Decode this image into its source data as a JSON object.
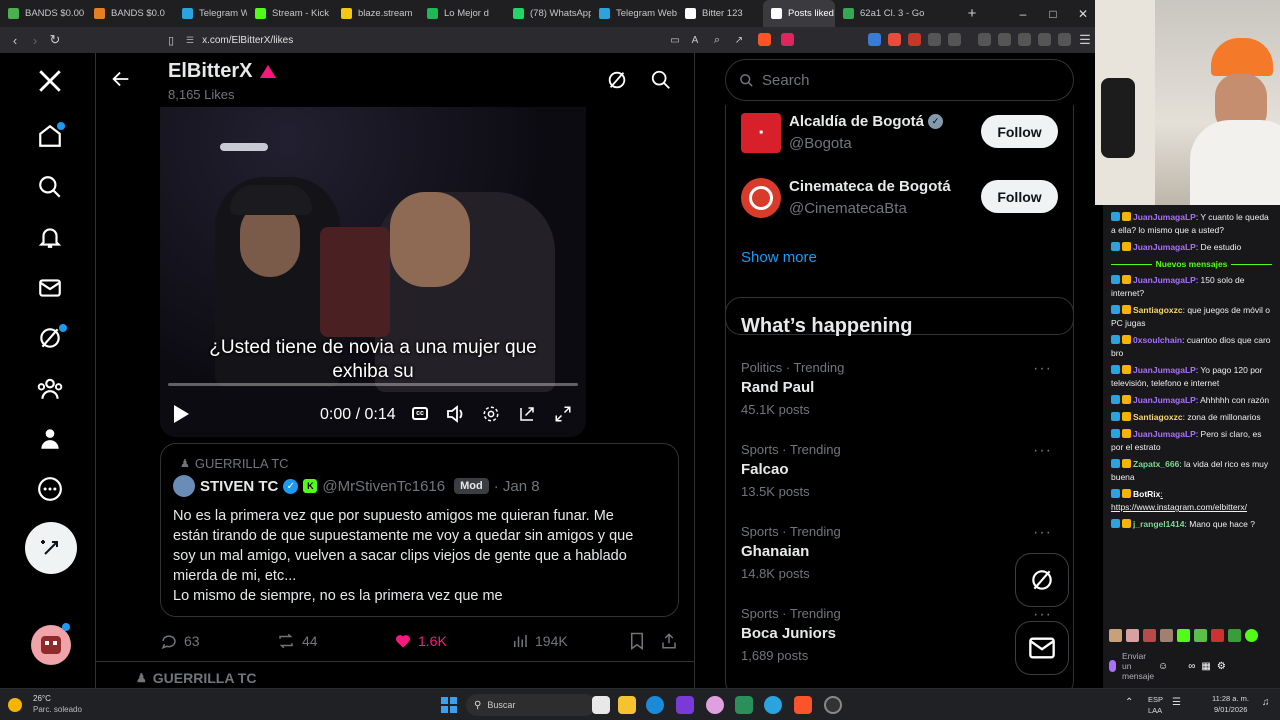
{
  "tabs": [
    {
      "label": "BANDS $0.00",
      "color": "#4caf50"
    },
    {
      "label": "BANDS $0.0",
      "color": "#e67e22"
    },
    {
      "label": "Telegram Web",
      "color": "#2aa3de"
    },
    {
      "label": "Stream - Kick",
      "color": "#53fc18"
    },
    {
      "label": "blaze.stream",
      "color": "#f5c518"
    },
    {
      "label": "Lo Mejor d",
      "color": "#1db954"
    },
    {
      "label": "(78) WhatsApp",
      "color": "#25d366"
    },
    {
      "label": "Telegram Web",
      "color": "#2aa3de"
    },
    {
      "label": "Bitter 123",
      "color": "#ffffff"
    },
    {
      "label": "Posts liked",
      "color": "#ffffff",
      "active": true
    },
    {
      "label": "62a1 Cl. 3 - Go",
      "color": "#34a853"
    }
  ],
  "browser": {
    "url": "x.com/ElBitterX/likes"
  },
  "profile": {
    "name": "ElBitterX",
    "likes_count": "8,165 Likes"
  },
  "video": {
    "subtitle": "¿Usted tiene de novia a una mujer que exhiba su",
    "time": "0:00 / 0:14"
  },
  "quote": {
    "community": "GUERRILLA TC",
    "author_name": "STIVEN TC",
    "author_handle": "@MrStivenTc1616",
    "mod_badge": "Mod",
    "date": "· Jan 8",
    "text_line1": "No es la primera vez que por supuesto amigos me quieran funar. Me",
    "text_line2": "están tirando de que supuestamente me voy a quedar sin amigos y que",
    "text_line3": "soy un mal amigo, vuelven a sacar clips viejos de gente que a hablado",
    "text_line4": "mierda de mi, etc...",
    "text_line5": "Lo mismo de siempre, no es la primera vez que me"
  },
  "actions": {
    "replies": "63",
    "reposts": "44",
    "likes": "1.6K",
    "views": "194K"
  },
  "next_community": "GUERRILLA TC",
  "search": {
    "placeholder": "Search"
  },
  "who_to_follow": [
    {
      "name": "Alcaldía de Bogotá",
      "handle": "@Bogota",
      "button": "Follow"
    },
    {
      "name": "Cinemateca de Bogotá",
      "handle": "@CinematecaBta",
      "button": "Follow"
    }
  ],
  "show_more": "Show more",
  "happening": {
    "title": "What’s happening",
    "trends": [
      {
        "category": "Politics · Trending",
        "name": "Rand Paul",
        "count": "45.1K posts"
      },
      {
        "category": "Sports · Trending",
        "name": "Falcao",
        "count": "13.5K posts"
      },
      {
        "category": "Sports · Trending",
        "name": "Ghanaian",
        "count": "14.8K posts"
      },
      {
        "category": "Sports · Trending",
        "name": "Boca Juniors",
        "count": "1,689 posts"
      }
    ]
  },
  "chat": {
    "messages": [
      {
        "user": "JuanJumagaLP",
        "color": "#a970ff",
        "text": ": Y cuanto le queda a ella? lo mismo que a usted?"
      },
      {
        "user": "JuanJumagaLP",
        "color": "#a970ff",
        "text": ": De estudio"
      },
      {
        "divider": "Nuevos mensajes"
      },
      {
        "user": "JuanJumagaLP",
        "color": "#a970ff",
        "text": ": 150 solo de internet?"
      },
      {
        "user": "Santiagoxzc",
        "color": "#f5d76e",
        "text": ": que juegos de móvil o PC jugas"
      },
      {
        "user": "0xsoulchain",
        "color": "#a970ff",
        "text": ": cuantoo dios que caro bro"
      },
      {
        "user": "JuanJumagaLP",
        "color": "#a970ff",
        "text": ": Yo pago 120 por televisión, telefono e internet"
      },
      {
        "user": "JuanJumagaLP",
        "color": "#a970ff",
        "text": ": Ahhhhh con razón"
      },
      {
        "user": "Santiagoxzc",
        "color": "#f5d76e",
        "text": ": zona de millonarios"
      },
      {
        "user": "JuanJumagaLP",
        "color": "#a970ff",
        "text": ": Pero si claro, es por el estrato"
      },
      {
        "user": "Zapatx_666",
        "color": "#7bd88f",
        "text": ": la vida del rico es muy buena"
      },
      {
        "user": "BotRix",
        "color": "#ffffff",
        "text": ": https://www.instagram.com/elbitterx/"
      },
      {
        "user": "j_rangel1414",
        "color": "#7bd88f",
        "text": ": Mano que hace ?"
      }
    ],
    "input_placeholder": "Enviar un mensaje"
  },
  "taskbar": {
    "weather_temp": "26°C",
    "weather_desc": "Parc. soleado",
    "search_label": "Buscar",
    "lang": "ESP",
    "lang2": "LAA",
    "time": "11:28 a. m.",
    "date": "9/01/2026"
  },
  "colors": {
    "accent": "#1d9bf0",
    "like": "#f91880",
    "kick": "#53fc18",
    "pink_triangle": "#f91880"
  }
}
